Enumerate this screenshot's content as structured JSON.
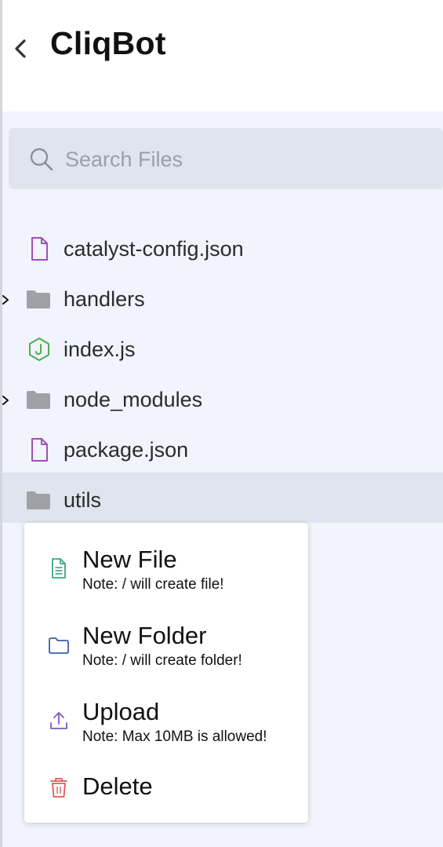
{
  "header": {
    "title": "CliqBot",
    "back_icon": "chevron-left-icon"
  },
  "search": {
    "placeholder": "Search Files",
    "value": "",
    "icon": "search-icon"
  },
  "tree": {
    "items": [
      {
        "label": "catalyst-config.json",
        "icon": "json-file-icon",
        "expandable": false,
        "selected": false
      },
      {
        "label": "handlers",
        "icon": "folder-icon",
        "expandable": true,
        "selected": false
      },
      {
        "label": "index.js",
        "icon": "nodejs-file-icon",
        "expandable": false,
        "selected": false
      },
      {
        "label": "node_modules",
        "icon": "folder-icon",
        "expandable": true,
        "selected": false
      },
      {
        "label": "package.json",
        "icon": "json-file-icon",
        "expandable": false,
        "selected": false
      },
      {
        "label": "utils",
        "icon": "folder-icon",
        "expandable": false,
        "selected": true
      }
    ]
  },
  "context_menu": {
    "items": [
      {
        "label": "New File",
        "note": "Note: / will create file!",
        "icon": "new-file-icon"
      },
      {
        "label": "New Folder",
        "note": "Note: / will create folder!",
        "icon": "new-folder-icon"
      },
      {
        "label": "Upload",
        "note": "Note: Max 10MB is allowed!",
        "icon": "upload-icon"
      },
      {
        "label": "Delete",
        "icon": "trash-icon"
      }
    ]
  },
  "colors": {
    "background": "#f1f4fc",
    "header_background": "#ffffff",
    "search_background": "#e0e4ee",
    "selected_row": "#e0e4ee",
    "json_icon": "#a14fb5",
    "nodejs_icon": "#4caf50",
    "folder_icon": "#9ea1a6",
    "new_file_icon": "#3aa58a",
    "new_folder_icon": "#3d5ea8",
    "upload_icon": "#7a5cc0",
    "delete_icon": "#e0585a"
  }
}
